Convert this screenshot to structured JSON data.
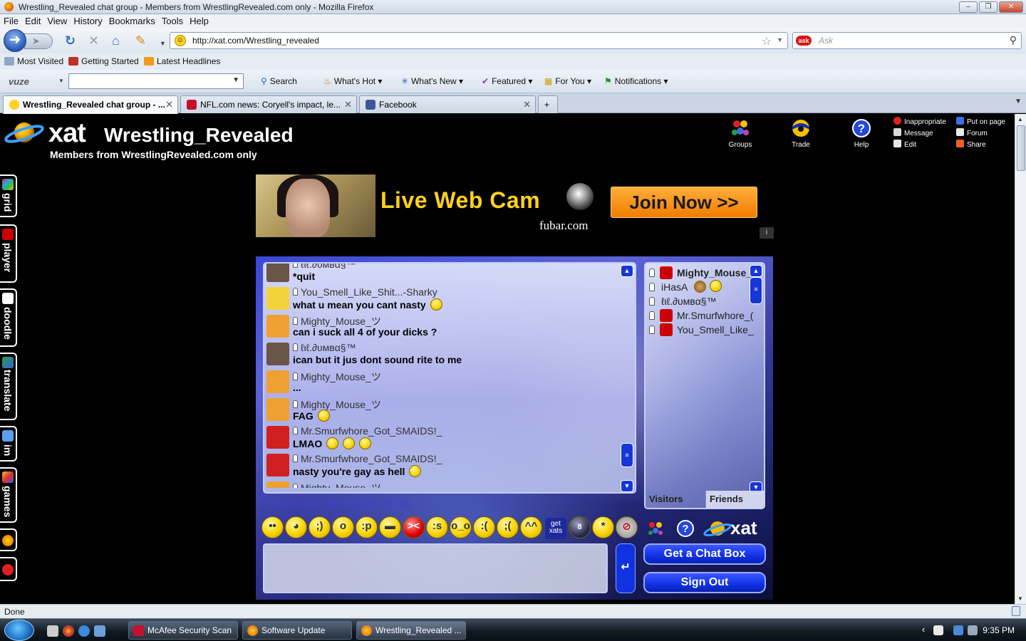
{
  "window": {
    "title": "Wrestling_Revealed chat group - Members from WrestlingRevealed.com only - Mozilla Firefox",
    "buttons": [
      "–",
      "❒",
      "✕"
    ]
  },
  "menu": [
    "File",
    "Edit",
    "View",
    "History",
    "Bookmarks",
    "Tools",
    "Help"
  ],
  "nav": {
    "url": "http://xat.com/Wrestling_revealed",
    "search_placeholder": "Ask",
    "search_engine": "ask"
  },
  "bookmarks": [
    "Most Visited",
    "Getting Started",
    "Latest Headlines"
  ],
  "vuze_toolbar": {
    "logo": "vuze",
    "items": [
      "Search",
      "What's Hot",
      "What's New",
      "Featured",
      "For You",
      "Notifications"
    ]
  },
  "tabs": [
    {
      "label": "Wrestling_Revealed chat group - ...",
      "active": true
    },
    {
      "label": "NFL.com news: Coryell's impact, le...",
      "active": false
    },
    {
      "label": "Facebook",
      "active": false
    }
  ],
  "xat": {
    "logo_text": "xat",
    "group_name": "Wrestling_Revealed",
    "group_desc": "Members from WrestlingRevealed.com only",
    "header_buttons": [
      "Groups",
      "Trade",
      "Help"
    ],
    "header_links": [
      "Inappropriate",
      "Message",
      "Edit",
      "Put on page",
      "Forum",
      "Share"
    ],
    "side_tabs": [
      "grid",
      "player",
      "doodle",
      "translate",
      "im",
      "games"
    ],
    "ad": {
      "headline": "Live Web Cam",
      "brand": "fubar.com",
      "cta": "Join Now >>",
      "info": "i"
    },
    "messages": [
      {
        "name": "ℓιℓ.∂υмвα§™",
        "text": "*quit",
        "avatar": "#6b5448",
        "smileys": 0
      },
      {
        "name": "You_Smell_Like_Shit...-Sharky",
        "text": "what u mean you cant nasty",
        "avatar": "#f3d33a",
        "smileys": 1
      },
      {
        "name": "Mighty_Mouse_ツ",
        "text": "can i suck all 4 of your dicks ?",
        "avatar": "#f0a030",
        "smileys": 0
      },
      {
        "name": "ℓιℓ.∂υмвα§™",
        "text": "ican but it jus dont sound rite to me",
        "avatar": "#6b5448",
        "smileys": 0
      },
      {
        "name": "Mighty_Mouse_ツ",
        "text": "...",
        "avatar": "#f0a030",
        "smileys": 0
      },
      {
        "name": "Mighty_Mouse_ツ",
        "text": "FAG",
        "avatar": "#f0a030",
        "smileys": 1
      },
      {
        "name": "Mr.Smurfwhore_Got_SMAIDS!_",
        "text": "LMAO",
        "avatar": "#d02020",
        "smileys": 3
      },
      {
        "name": "Mr.Smurfwhore_Got_SMAIDS!_",
        "text": "nasty you're gay as hell",
        "avatar": "#d02020",
        "smileys": 1
      },
      {
        "name": "Mighty_Mouse_ツ",
        "text": "",
        "avatar": "#f0a030",
        "smileys": 0
      }
    ],
    "users": [
      {
        "name": "Mighty_Mouse_",
        "youtube": true,
        "bold": true
      },
      {
        "name": "iHasA",
        "youtube": false,
        "bold": false
      },
      {
        "name": "ℓιℓ.∂υмвα§™",
        "youtube": false,
        "bold": false
      },
      {
        "name": "Mr.Smurfwhore_(",
        "youtube": true,
        "bold": false
      },
      {
        "name": "You_Smell_Like_",
        "youtube": true,
        "bold": false
      }
    ],
    "user_tabs": [
      "Visitors",
      "Friends"
    ],
    "watermark": "OFFICIAL WR CHAT BOX",
    "get_xats": "get xats",
    "buttons": {
      "get_chat_box": "Get a Chat Box",
      "sign_out": "Sign Out"
    }
  },
  "status": "Done",
  "taskbar": {
    "tasks": [
      "McAfee Security Scan",
      "Software Update",
      "Wrestling_Revealed ..."
    ],
    "clock": "9:35 PM"
  }
}
